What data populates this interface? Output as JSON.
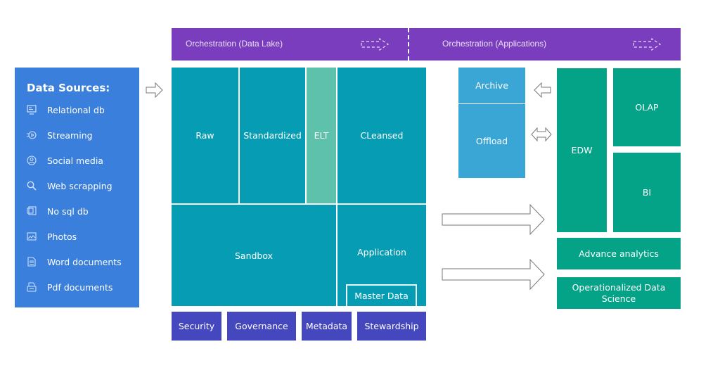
{
  "orchestration": {
    "data_lake": "Orchestration (Data Lake)",
    "applications": "Orchestration (Applications)"
  },
  "data_sources": {
    "title": "Data Sources:",
    "items": [
      {
        "label": "Relational db",
        "icon": "database-monitor-icon"
      },
      {
        "label": "Streaming",
        "icon": "streaming-play-icon"
      },
      {
        "label": "Social media",
        "icon": "user-circle-icon"
      },
      {
        "label": "Web scrapping",
        "icon": "search-icon"
      },
      {
        "label": "No sql db",
        "icon": "nosql-file-icon"
      },
      {
        "label": "Photos",
        "icon": "image-icon"
      },
      {
        "label": "Word documents",
        "icon": "document-icon"
      },
      {
        "label": "Pdf documents",
        "icon": "pdf-printer-icon"
      }
    ]
  },
  "data_lake": {
    "raw": "Raw",
    "standardized": "Standardized",
    "elt": "ELT",
    "cleansed": "CLeansed",
    "sandbox": "Sandbox",
    "application": "Application",
    "master_data": "Master Data"
  },
  "governance": [
    "Security",
    "Governance",
    "Metadata",
    "Stewardship"
  ],
  "storage": {
    "archive": "Archive",
    "offload": "Offload"
  },
  "analytics": {
    "edw": "EDW",
    "olap": "OLAP",
    "bi": "BI",
    "advance_analytics": "Advance analytics",
    "operationalized": "Operationalized Data Science"
  },
  "colors": {
    "orchestration": "#7a3dbe",
    "sources": "#3a7fdc",
    "lake": "#069db4",
    "elt": "#5ec1ac",
    "archive": "#3aa6d6",
    "analytics": "#04a287",
    "governance": "#4447bd"
  }
}
